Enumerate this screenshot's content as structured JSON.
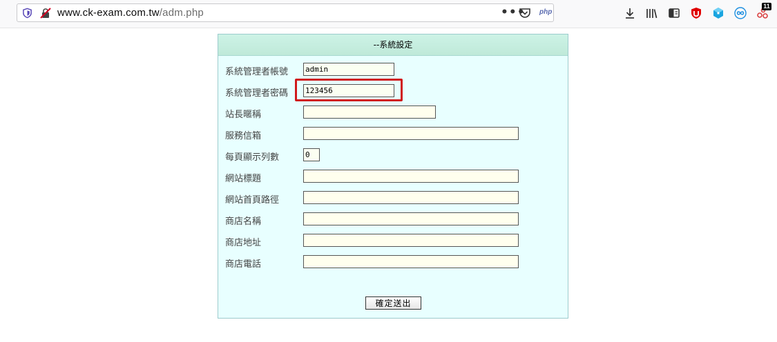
{
  "browser": {
    "url_host": "www.ck-exam.com.tw",
    "url_path": "/adm.php",
    "more_label": "•••",
    "php_label": "php",
    "badge_count": "11"
  },
  "panel": {
    "title": "--系統設定",
    "submit_label": "確定送出"
  },
  "form": {
    "admin_account": {
      "label": "系統管理者帳號",
      "value": "admin"
    },
    "admin_password": {
      "label": "系統管理者密碼",
      "value": "123456"
    },
    "site_nickname": {
      "label": "站長暱稱",
      "value": ""
    },
    "service_email": {
      "label": "服務信箱",
      "value": ""
    },
    "rows_per_page": {
      "label": "每頁顯示列數",
      "value": "0"
    },
    "site_title": {
      "label": "網站標題",
      "value": ""
    },
    "homepage_path": {
      "label": "網站首頁路徑",
      "value": ""
    },
    "shop_name": {
      "label": "商店名稱",
      "value": ""
    },
    "shop_address": {
      "label": "商店地址",
      "value": ""
    },
    "shop_phone": {
      "label": "商店電話",
      "value": ""
    }
  }
}
